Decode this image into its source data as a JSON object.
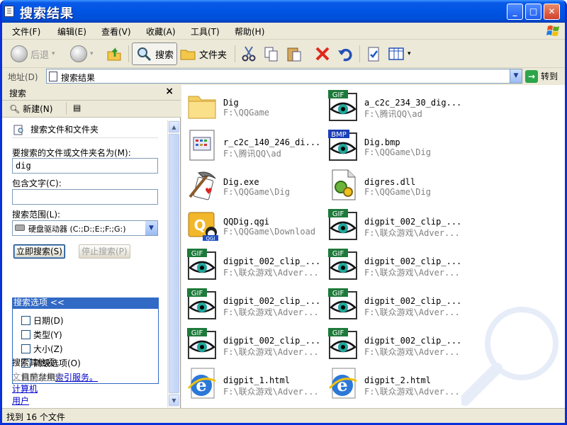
{
  "window": {
    "title": "搜索结果"
  },
  "menubar": [
    "文件(F)",
    "编辑(E)",
    "查看(V)",
    "收藏(A)",
    "工具(T)",
    "帮助(H)"
  ],
  "toolbar": {
    "back": "后退",
    "search": "搜索",
    "folders": "文件夹"
  },
  "address": {
    "label": "地址(D)",
    "value": "搜索结果",
    "go": "转到"
  },
  "search_pane": {
    "title": "搜索",
    "new_button": "新建(N)",
    "section_title": "搜索文件和文件夹",
    "name_label": "要搜索的文件或文件夹名为(M):",
    "name_value": "dig",
    "contains_label": "包含文字(C):",
    "contains_value": "",
    "scope_label": "搜索范围(L):",
    "scope_value": "硬盘驱动器 (C:;D:;E:;F:;G:)",
    "search_now": "立即搜索(S)",
    "stop_search": "停止搜索(P)",
    "options_title": "搜索选项 <<",
    "options": [
      "日期(D)",
      "类型(Y)",
      "大小(Z)",
      "高级选项(O)"
    ],
    "index_prefix": "目前禁用",
    "index_link": "索引服务。",
    "other_title": "搜索其他项:",
    "other_links": [
      "文件或文件夹",
      "计算机",
      "用户"
    ]
  },
  "files": [
    {
      "name": "Dig",
      "path": "F:\\QQGame",
      "icon": "folder-icon"
    },
    {
      "name": "a_c2c_234_30_dig...",
      "path": "F:\\腾讯QQ\\ad",
      "icon": "gif-file-icon"
    },
    {
      "name": "r_c2c_140_246_di...",
      "path": "F:\\腾讯QQ\\ad",
      "icon": "image-file-icon"
    },
    {
      "name": "Dig.bmp",
      "path": "F:\\QQGame\\Dig",
      "icon": "bmp-file-icon"
    },
    {
      "name": "Dig.exe",
      "path": "F:\\QQGame\\Dig",
      "icon": "exe-file-icon"
    },
    {
      "name": "digres.dll",
      "path": "F:\\QQGame\\Dig",
      "icon": "dll-file-icon"
    },
    {
      "name": "QQDig.qgi",
      "path": "F:\\QQGame\\Download",
      "icon": "qgi-file-icon"
    },
    {
      "name": "digpit_002_clip_...",
      "path": "F:\\联众游戏\\Adver...",
      "icon": "gif-file-icon"
    },
    {
      "name": "digpit_002_clip_...",
      "path": "F:\\联众游戏\\Adver...",
      "icon": "gif-file-icon"
    },
    {
      "name": "digpit_002_clip_...",
      "path": "F:\\联众游戏\\Adver...",
      "icon": "gif-file-icon"
    },
    {
      "name": "digpit_002_clip_...",
      "path": "F:\\联众游戏\\Adver...",
      "icon": "gif-file-icon"
    },
    {
      "name": "digpit_002_clip_...",
      "path": "F:\\联众游戏\\Adver...",
      "icon": "gif-file-icon"
    },
    {
      "name": "digpit_002_clip_...",
      "path": "F:\\联众游戏\\Adver...",
      "icon": "gif-file-icon"
    },
    {
      "name": "digpit_002_clip_...",
      "path": "F:\\联众游戏\\Adver...",
      "icon": "gif-file-icon"
    },
    {
      "name": "digpit_1.html",
      "path": "F:\\联众游戏\\Adver...",
      "icon": "html-file-icon"
    },
    {
      "name": "digpit_2.html",
      "path": "F:\\联众游戏\\Adver...",
      "icon": "html-file-icon"
    }
  ],
  "status": {
    "text": "找到 16 个文件"
  },
  "colors": {
    "titlebar": "#0054e3",
    "options_header": "#316ac5",
    "chrome": "#ece9d8"
  }
}
